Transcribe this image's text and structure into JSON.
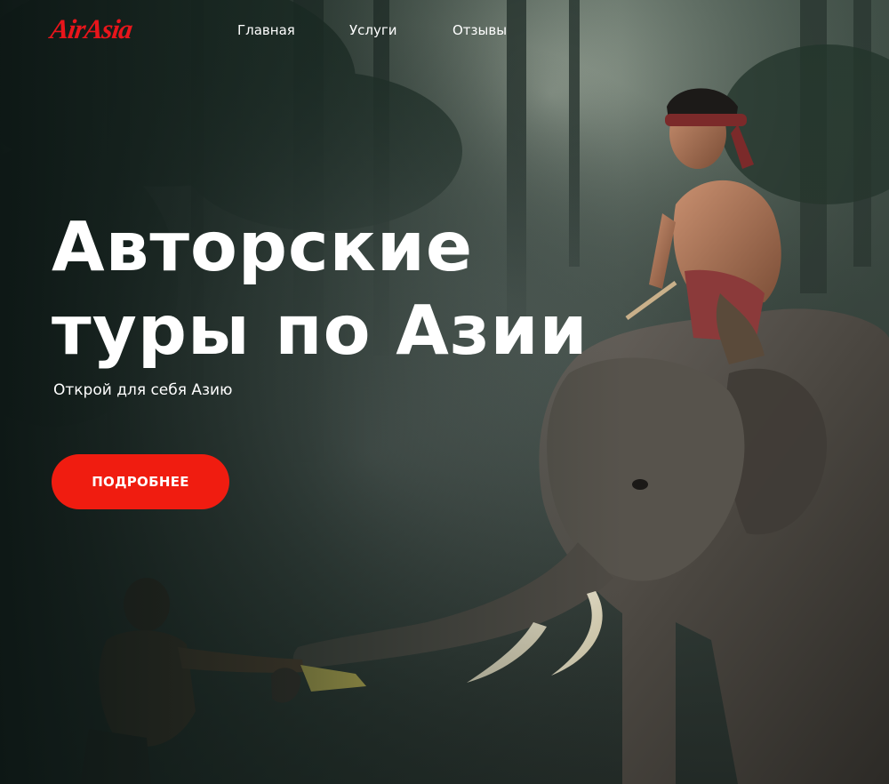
{
  "brand": {
    "logo_text": "AirAsia",
    "color": "#e8151b"
  },
  "nav": {
    "items": [
      {
        "label": "Главная"
      },
      {
        "label": "Услуги"
      },
      {
        "label": "Отзывы"
      }
    ]
  },
  "hero": {
    "title_line1": "Авторские",
    "title_line2": "туры по Азии",
    "subtitle": "Открой для себя Азию",
    "cta_label": "ПОДРОБНЕЕ",
    "cta_color": "#f01c10",
    "background": "elephant-with-rider-in-misty-forest-photo"
  }
}
